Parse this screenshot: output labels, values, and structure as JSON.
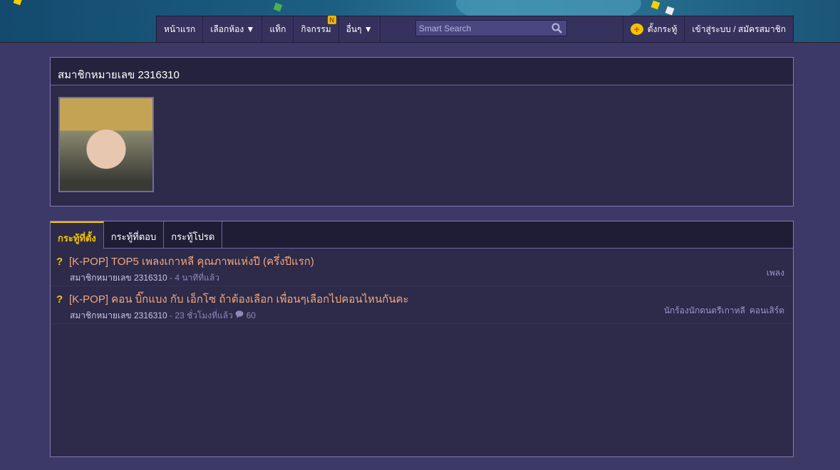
{
  "nav": {
    "items": [
      "หน้าแรก",
      "เลือกห้อง ▼",
      "แท็ก",
      "กิจกรรม",
      "อื่นๆ ▼"
    ],
    "badge": "N",
    "search_placeholder": "Smart Search",
    "create_topic": "ตั้งกระทู้",
    "login": "เข้าสู่ระบบ / สมัครสมาชิก"
  },
  "profile": {
    "title": "สมาชิกหมายเลข 2316310"
  },
  "tabs": [
    "กระทู้ที่ตั้ง",
    "กระทู้ที่ตอบ",
    "กระทู้โปรด"
  ],
  "topics": [
    {
      "title": "[K-POP] TOP5 เพลงเกาหลี คุณภาพแห่งปี (ครึ่งปีแรก)",
      "author": "สมาชิกหมายเลข 2316310",
      "time": "- 4 นาทีที่แล้ว",
      "comments": "",
      "tags": [
        "เพลง"
      ]
    },
    {
      "title": "[K-POP] คอน บิ๊กแบง กับ เอ็กโซ ถ้าต้องเลือก เพื่อนๆเลือกไปคอนไหนกันคะ",
      "author": "สมาชิกหมายเลข 2316310",
      "time": "- 23 ชั่วโมงที่แล้ว",
      "comments": "60",
      "tags": [
        "นักร้องนักดนตรีเกาหลี",
        "คอนเสิร์ต"
      ]
    }
  ]
}
